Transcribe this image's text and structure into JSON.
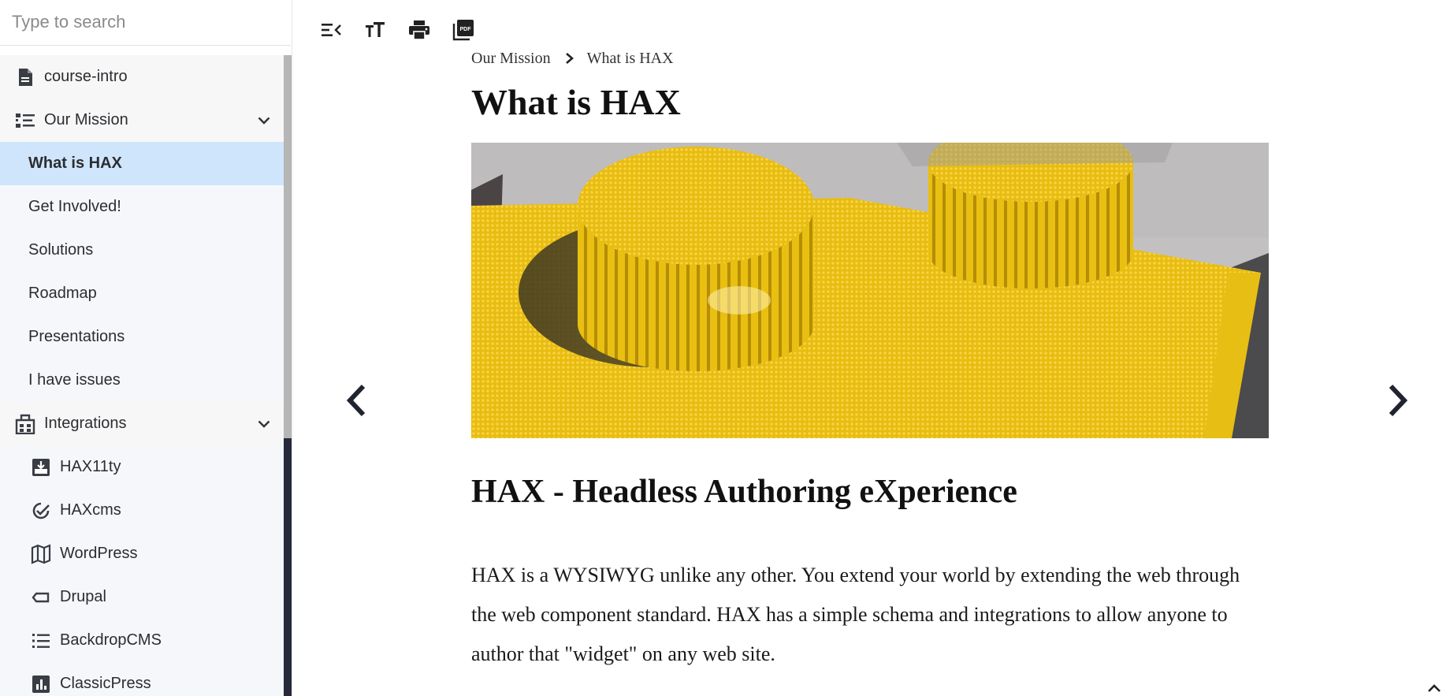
{
  "search": {
    "placeholder": "Type to search"
  },
  "menu": {
    "course_intro": "course-intro",
    "our_mission": "Our Mission",
    "mission_items": [
      "What is HAX",
      "Get Involved!",
      "Solutions",
      "Roadmap",
      "Presentations",
      "I have issues"
    ],
    "integrations": "Integrations",
    "integration_items": [
      "HAX11ty",
      "HAXcms",
      "WordPress",
      "Drupal",
      "BackdropCMS",
      "ClassicPress"
    ]
  },
  "breadcrumb": {
    "parent": "Our Mission",
    "current": "What is HAX"
  },
  "page": {
    "title": "What is HAX",
    "heading": "HAX - Headless Authoring eXperience",
    "body": "HAX is a WYSIWYG unlike any other. You extend your world by extending the web through the web component standard. HAX has a simple schema and integrations to allow anyone to author that \"widget\" on any web site."
  },
  "colors": {
    "active_bg": "#cfe5fb",
    "sidebar_bg": "#f5f7fa",
    "scroll_track": "#262a3b",
    "brick_yellow": "#f2c80f"
  },
  "icons": [
    "document-icon",
    "outline-list-icon",
    "building-icon",
    "inbox-download-icon",
    "check-badge-icon",
    "map-icon",
    "label-icon",
    "bullet-list-icon",
    "bar-chart-icon"
  ]
}
